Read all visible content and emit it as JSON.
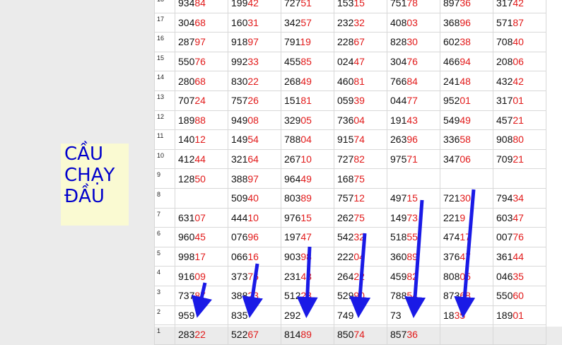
{
  "label": {
    "lines": [
      "CẦU",
      "CHẠY",
      "ĐẦU"
    ]
  },
  "rows": [
    {
      "n": "18",
      "cells": [
        [
          "934",
          "84"
        ],
        [
          "199",
          "42"
        ],
        [
          "727",
          "51"
        ],
        [
          "153",
          "15"
        ],
        [
          "751",
          "78"
        ],
        [
          "897",
          "36"
        ],
        [
          "317",
          "42"
        ]
      ]
    },
    {
      "n": "17",
      "cells": [
        [
          "304",
          "68"
        ],
        [
          "160",
          "31"
        ],
        [
          "342",
          "57"
        ],
        [
          "232",
          "32"
        ],
        [
          "408",
          "03"
        ],
        [
          "368",
          "96"
        ],
        [
          "571",
          "87"
        ]
      ]
    },
    {
      "n": "16",
      "cells": [
        [
          "287",
          "97"
        ],
        [
          "918",
          "97"
        ],
        [
          "791",
          "19"
        ],
        [
          "228",
          "67"
        ],
        [
          "828",
          "30"
        ],
        [
          "602",
          "38"
        ],
        [
          "708",
          "40"
        ]
      ]
    },
    {
      "n": "15",
      "cells": [
        [
          "550",
          "76"
        ],
        [
          "992",
          "33"
        ],
        [
          "455",
          "85"
        ],
        [
          "024",
          "47"
        ],
        [
          "304",
          "76"
        ],
        [
          "466",
          "94"
        ],
        [
          "208",
          "06"
        ]
      ]
    },
    {
      "n": "14",
      "cells": [
        [
          "280",
          "68"
        ],
        [
          "830",
          "22"
        ],
        [
          "268",
          "49"
        ],
        [
          "460",
          "81"
        ],
        [
          "766",
          "84"
        ],
        [
          "241",
          "48"
        ],
        [
          "432",
          "42"
        ]
      ]
    },
    {
      "n": "13",
      "cells": [
        [
          "707",
          "24"
        ],
        [
          "757",
          "26"
        ],
        [
          "151",
          "81"
        ],
        [
          "059",
          "39"
        ],
        [
          "044",
          "77"
        ],
        [
          "952",
          "01"
        ],
        [
          "317",
          "01"
        ]
      ]
    },
    {
      "n": "12",
      "cells": [
        [
          "189",
          "88"
        ],
        [
          "949",
          "08"
        ],
        [
          "329",
          "05"
        ],
        [
          "736",
          "04"
        ],
        [
          "191",
          "43"
        ],
        [
          "549",
          "49"
        ],
        [
          "457",
          "21"
        ]
      ]
    },
    {
      "n": "11",
      "cells": [
        [
          "140",
          "12"
        ],
        [
          "149",
          "54"
        ],
        [
          "788",
          "04"
        ],
        [
          "915",
          "74"
        ],
        [
          "263",
          "96"
        ],
        [
          "336",
          "58"
        ],
        [
          "908",
          "80"
        ]
      ]
    },
    {
      "n": "10",
      "cells": [
        [
          "412",
          "44"
        ],
        [
          "321",
          "64"
        ],
        [
          "267",
          "10"
        ],
        [
          "727",
          "82"
        ],
        [
          "975",
          "71"
        ],
        [
          "347",
          "06"
        ],
        [
          "709",
          "21"
        ]
      ]
    },
    {
      "n": "9",
      "cells": [
        [
          "128",
          "50"
        ],
        [
          "388",
          "97"
        ],
        [
          "964",
          "49"
        ],
        [
          "168",
          "75"
        ],
        [
          "",
          ""
        ],
        [
          "",
          ""
        ],
        [
          "",
          ""
        ]
      ]
    },
    {
      "n": "8",
      "cells": [
        [
          "",
          ""
        ],
        [
          "509",
          "40"
        ],
        [
          "803",
          "89"
        ],
        [
          "757",
          "12"
        ],
        [
          "497",
          "15"
        ],
        [
          "721",
          "30"
        ],
        [
          "794",
          "34"
        ]
      ]
    },
    {
      "n": "7",
      "cells": [
        [
          "631",
          "07"
        ],
        [
          "444",
          "10"
        ],
        [
          "976",
          "15"
        ],
        [
          "262",
          "75"
        ],
        [
          "149",
          "73"
        ],
        [
          "221",
          "9"
        ],
        [
          "603",
          "47"
        ]
      ]
    },
    {
      "n": "6",
      "cells": [
        [
          "960",
          "45"
        ],
        [
          "076",
          "96"
        ],
        [
          "197",
          "47"
        ],
        [
          "542",
          "32"
        ],
        [
          "518",
          "55"
        ],
        [
          "474",
          "17"
        ],
        [
          "007",
          "76"
        ]
      ]
    },
    {
      "n": "5",
      "cells": [
        [
          "998",
          "17"
        ],
        [
          "066",
          "16"
        ],
        [
          "903",
          "98"
        ],
        [
          "222",
          "04"
        ],
        [
          "360",
          "89"
        ],
        [
          "376",
          "47"
        ],
        [
          "361",
          "44"
        ]
      ]
    },
    {
      "n": "4",
      "cells": [
        [
          "916",
          "09"
        ],
        [
          "373",
          "76"
        ],
        [
          "231",
          "43"
        ],
        [
          "264",
          "22"
        ],
        [
          "459",
          "82"
        ],
        [
          "808",
          "05"
        ],
        [
          "046",
          "35"
        ]
      ]
    },
    {
      "n": "3",
      "cells": [
        [
          "737",
          "87"
        ],
        [
          "388",
          "23"
        ],
        [
          "512",
          "23"
        ],
        [
          "529",
          "90"
        ],
        [
          "788",
          "54"
        ],
        [
          "873",
          "68"
        ],
        [
          "550",
          "60"
        ]
      ]
    },
    {
      "n": "2",
      "cells": [
        [
          "959",
          ""
        ],
        [
          "835",
          ""
        ],
        [
          "292",
          ""
        ],
        [
          "749",
          ""
        ],
        [
          "73",
          ""
        ],
        [
          "18",
          "35"
        ],
        [
          "189",
          "01"
        ]
      ]
    },
    {
      "n": "1",
      "cells": [
        [
          "283",
          "22"
        ],
        [
          "522",
          "67"
        ],
        [
          "814",
          "89"
        ],
        [
          "850",
          "74"
        ],
        [
          "857",
          "36"
        ],
        [
          "",
          ""
        ],
        [
          "",
          ""
        ]
      ]
    }
  ],
  "arrow_color": "#1a1ae6"
}
